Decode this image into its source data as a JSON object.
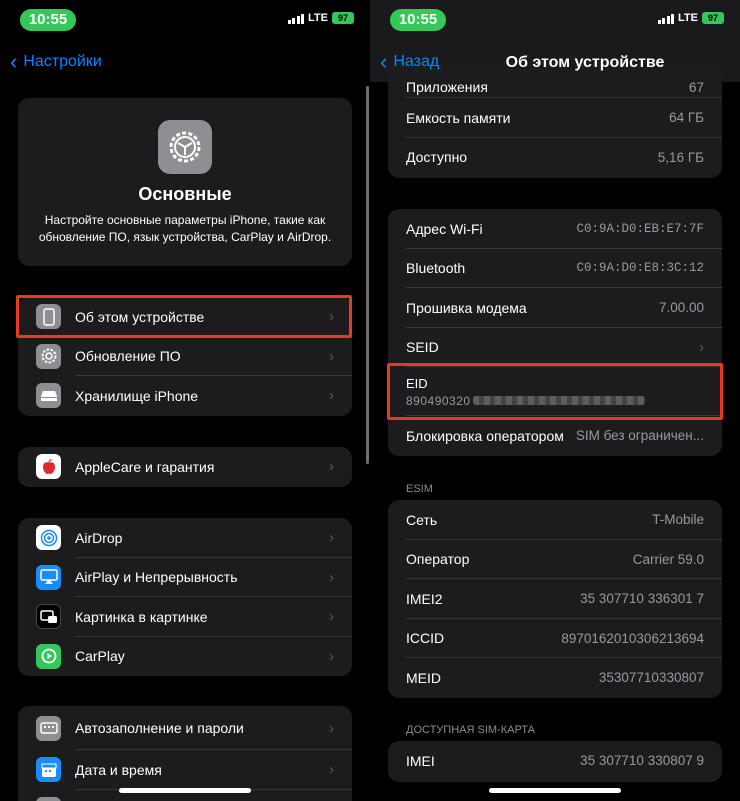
{
  "status": {
    "time": "10:55",
    "network": "LTE",
    "battery": "97"
  },
  "left": {
    "back_label": "Настройки",
    "header": {
      "title": "Основные",
      "description": "Настройте основные параметры iPhone, такие как обновление ПО, язык устройства, CarPlay и AirDrop."
    },
    "group1": [
      {
        "label": "Об этом устройстве",
        "icon": "iphone-icon",
        "highlighted": true
      },
      {
        "label": "Обновление ПО",
        "icon": "gear-update-icon"
      },
      {
        "label": "Хранилище iPhone",
        "icon": "storage-icon"
      }
    ],
    "group2": [
      {
        "label": "AppleCare и гарантия",
        "icon": "apple-icon"
      }
    ],
    "group3": [
      {
        "label": "AirDrop",
        "icon": "airdrop-icon"
      },
      {
        "label": "AirPlay и Непрерывность",
        "icon": "airplay-icon"
      },
      {
        "label": "Картинка в картинке",
        "icon": "pip-icon"
      },
      {
        "label": "CarPlay",
        "icon": "carplay-icon"
      }
    ],
    "group4": [
      {
        "label": "Автозаполнение и пароли",
        "icon": "keyboard-icon"
      },
      {
        "label": "Дата и время",
        "icon": "calendar-icon"
      }
    ]
  },
  "right": {
    "back_label": "Назад",
    "title": "Об этом устройстве",
    "group_top": [
      {
        "label": "Приложения",
        "value": "67"
      },
      {
        "label": "Емкость памяти",
        "value": "64 ГБ"
      },
      {
        "label": "Доступно",
        "value": "5,16 ГБ"
      }
    ],
    "group_net": [
      {
        "label": "Адрес Wi-Fi",
        "value": "C0:9A:D0:EB:E7:7F"
      },
      {
        "label": "Bluetooth",
        "value": "C0:9A:D0:E8:3C:12"
      },
      {
        "label": "Прошивка модема",
        "value": "7.00.00"
      },
      {
        "label": "SEID",
        "value": ""
      },
      {
        "label": "EID",
        "value": "890490320"
      },
      {
        "label": "Блокировка оператором",
        "value": "SIM без ограничен..."
      }
    ],
    "esim_header": "ESIM",
    "group_esim": [
      {
        "label": "Сеть",
        "value": "T-Mobile"
      },
      {
        "label": "Оператор",
        "value": "Carrier 59.0"
      },
      {
        "label": "IMEI2",
        "value": "35 307710 336301 7"
      },
      {
        "label": "ICCID",
        "value": "8970162010306213694"
      },
      {
        "label": "MEID",
        "value": "35307710330807"
      }
    ],
    "sim_header": "ДОСТУПНАЯ SIM-КАРТА",
    "group_sim": [
      {
        "label": "IMEI",
        "value": "35 307710 330807 9"
      }
    ]
  },
  "colors": {
    "accent": "#0a84ff",
    "highlight": "#e83a23",
    "card": "#1c1c1e",
    "time_pill": "#34c759"
  }
}
